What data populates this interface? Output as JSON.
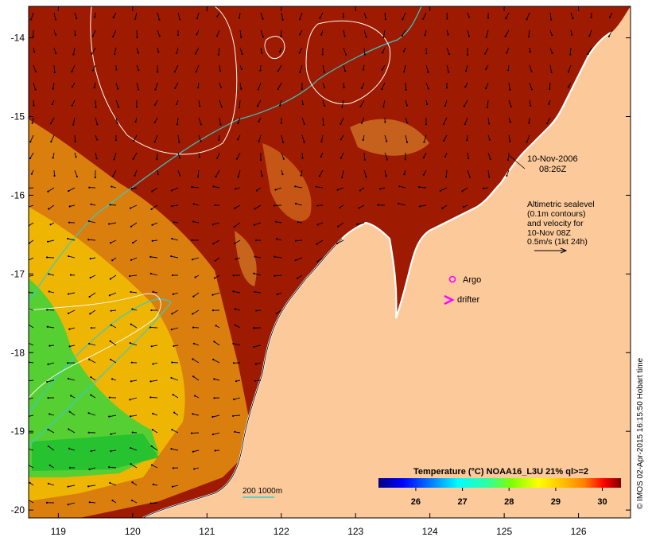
{
  "map": {
    "date_label": "10-Nov-2006",
    "time_label": "08:26Z",
    "altimetry_note": [
      "Altimetric sealevel",
      "(0.1m contours)",
      "and velocity for",
      "10-Nov 08Z",
      "0.5m/s (1kt 24h)"
    ],
    "legend_argo": "Argo",
    "legend_drifter": "drifter",
    "depth_contours_label": "200  1000m",
    "credit": "© IMOS 02-Apr-2015 16:15:50 Hobart time",
    "colorbar": {
      "title": "Temperature (°C) NOAA16_L3U 21% ql>=2",
      "ticks": [
        "26",
        "27",
        "28",
        "29",
        "30"
      ],
      "min": 25.2,
      "max": 30.4,
      "colors": [
        "#00007f",
        "#0000ff",
        "#007fff",
        "#00ffff",
        "#2fff9f",
        "#7fff00",
        "#ffff00",
        "#ffbf00",
        "#ff7f00",
        "#ff0000",
        "#7f0000"
      ]
    },
    "lon_ticks": [
      "119",
      "120",
      "121",
      "122",
      "123",
      "124",
      "125",
      "126"
    ],
    "lat_ticks": [
      "-14",
      "-15",
      "-16",
      "-17",
      "-18",
      "-19",
      "-20"
    ],
    "lon_range": [
      118.6,
      126.7
    ],
    "lat_range": [
      -20.1,
      -13.6
    ],
    "colors": {
      "land": "#fcc99a",
      "sea_hot": "#9e1a00",
      "coast": "#ffffff"
    }
  }
}
